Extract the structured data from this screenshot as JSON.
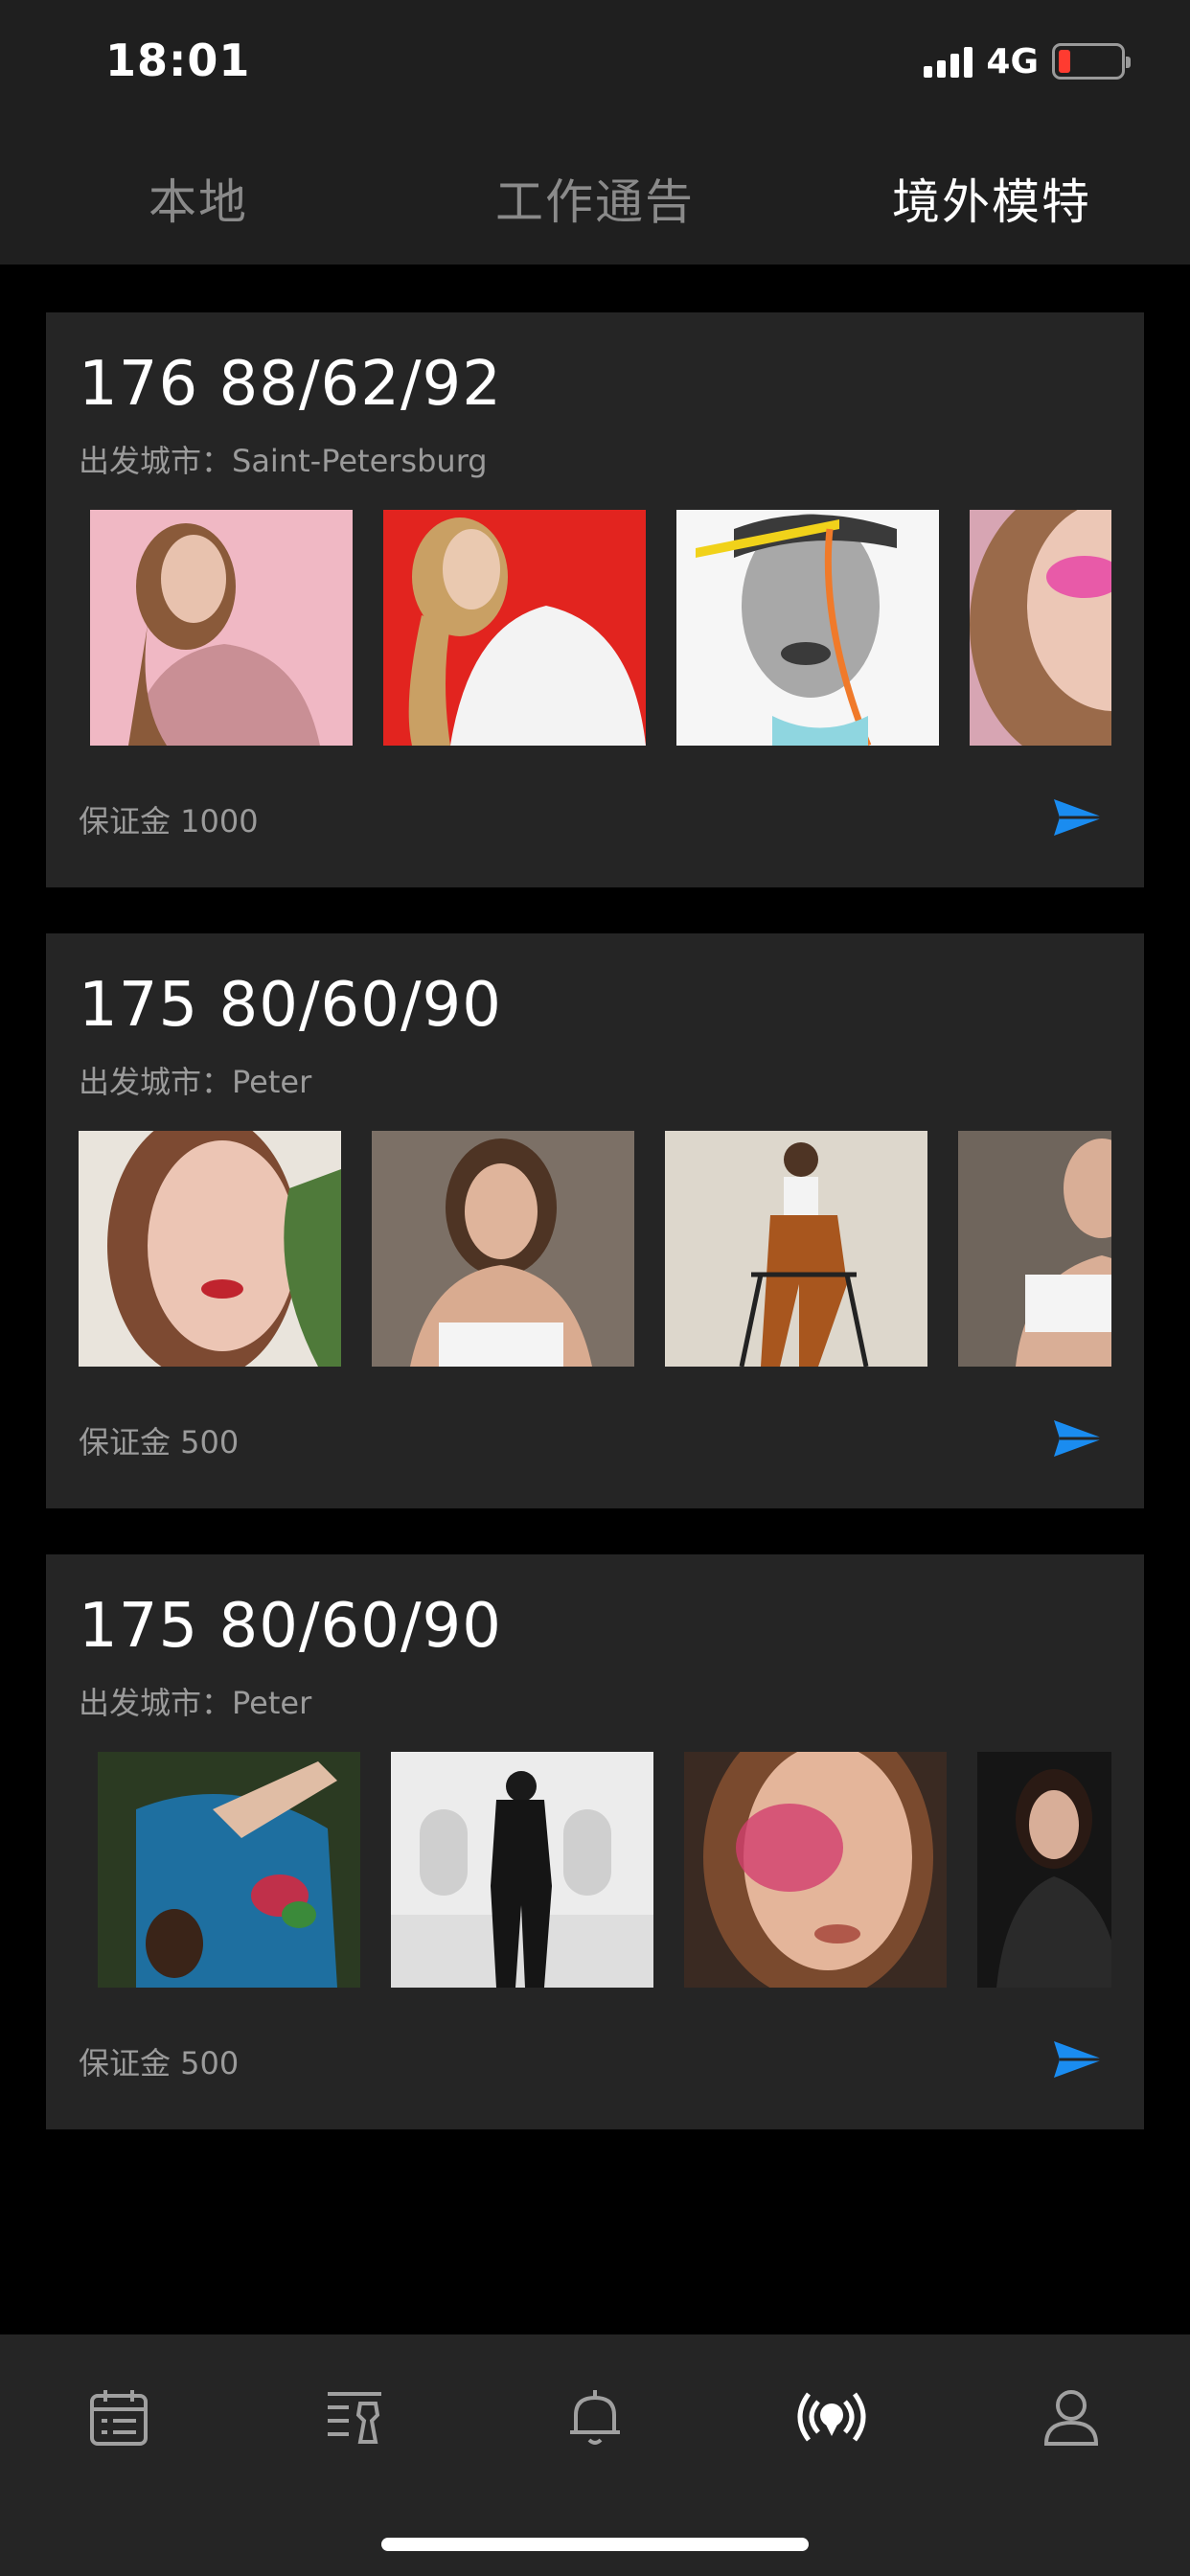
{
  "status_bar": {
    "time": "18:01",
    "network": "4G"
  },
  "tabs": [
    {
      "label": "本地",
      "active": false
    },
    {
      "label": "工作通告",
      "active": false
    },
    {
      "label": "境外模特",
      "active": true
    }
  ],
  "cards": [
    {
      "title": "176 88/62/92",
      "city": "出发城市：Saint-Petersburg",
      "deposit": "保证金 1000",
      "photos": [
        "model-photo-pink-dress",
        "model-photo-red-background",
        "model-photo-face-paint",
        "model-photo-pink-eyeshadow"
      ]
    },
    {
      "title": "175 80/60/90",
      "city": "出发城市：Peter",
      "deposit": "保证金 500",
      "photos": [
        "model-photo-closeup-plant",
        "model-photo-white-top",
        "model-photo-sitting-stool",
        "model-photo-profile"
      ]
    },
    {
      "title": "175 80/60/90",
      "city": "出发城市：Peter",
      "deposit": "保证金 500",
      "photos": [
        "model-photo-blue-chair",
        "model-photo-white-building",
        "model-photo-makeup-closeup",
        "model-photo-leather-outfit"
      ]
    }
  ],
  "tabbar": [
    "calendar-icon",
    "job-list-icon",
    "bell-icon",
    "broadcast-icon",
    "profile-icon"
  ],
  "colors": {
    "background": "#000000",
    "surface": "#252525",
    "header": "#1f1f1f",
    "accent": "#1a8cf0",
    "muted_text": "#9b9b9b"
  }
}
